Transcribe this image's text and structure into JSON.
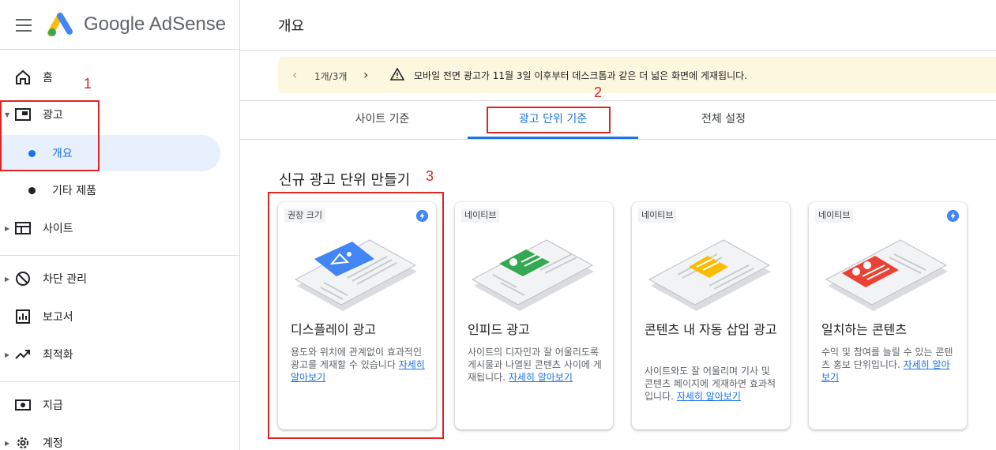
{
  "header": {
    "brand": "Google AdSense",
    "page_title": "개요"
  },
  "sidebar": {
    "items": [
      {
        "label": "홈",
        "icon": "home-icon"
      },
      {
        "label": "광고",
        "icon": "ads-icon"
      },
      {
        "label": "사이트",
        "icon": "sites-icon"
      },
      {
        "label": "차단 관리",
        "icon": "block-icon"
      },
      {
        "label": "보고서",
        "icon": "reports-icon"
      },
      {
        "label": "최적화",
        "icon": "trending-icon"
      },
      {
        "label": "지급",
        "icon": "payments-icon"
      },
      {
        "label": "계정",
        "icon": "settings-icon"
      }
    ],
    "subitems": [
      {
        "label": "개요",
        "active": true
      },
      {
        "label": "기타 제품",
        "active": false
      }
    ]
  },
  "banner": {
    "count": "1개/3개",
    "message": "모바일 전면 광고가 11월 3일 이후부터 데스크톱과 같은 더 넓은 화면에 게재됩니다."
  },
  "tabs": [
    {
      "label": "사이트 기준",
      "active": false
    },
    {
      "label": "광고 단위 기준",
      "active": true
    },
    {
      "label": "전체 설정",
      "active": false
    }
  ],
  "section_title": "신규 광고 단위 만들기",
  "cards": [
    {
      "chip": "권장 크기",
      "title": "디스플레이 광고",
      "desc": "용도와 위치에 관계없이 효과적인 광고를 게재할 수 있습니다",
      "link": "자세히 알아보기",
      "accent": "#4285f4"
    },
    {
      "chip": "네이티브",
      "title": "인피드 광고",
      "desc": "사이트의 디자인과 잘 어울리도록 게시물과 나열된 콘텐츠 사이에 게재됩니다.",
      "link": "자세히 알아보기",
      "accent": "#34a853"
    },
    {
      "chip": "네이티브",
      "title": "콘텐츠 내 자동 삽입 광고",
      "desc": "사이트와도 잘 어울리며 기사 및 콘텐츠 페이지에 게재하면 효과적입니다.",
      "link": "자세히 알아보기",
      "accent": "#fbbc04"
    },
    {
      "chip": "네이티브",
      "title": "일치하는 콘텐츠",
      "desc": "수익 및 참여를 늘릴 수 있는 콘텐츠 홍보 단위입니다.",
      "link": "자세히 알아보기",
      "accent": "#ea4335"
    }
  ],
  "annotations": {
    "n1": "1",
    "n2": "2",
    "n3": "3"
  },
  "colors": {
    "accent": "#1a73e8",
    "annotation_red": "#e02424",
    "banner_bg": "#fef7e0"
  }
}
